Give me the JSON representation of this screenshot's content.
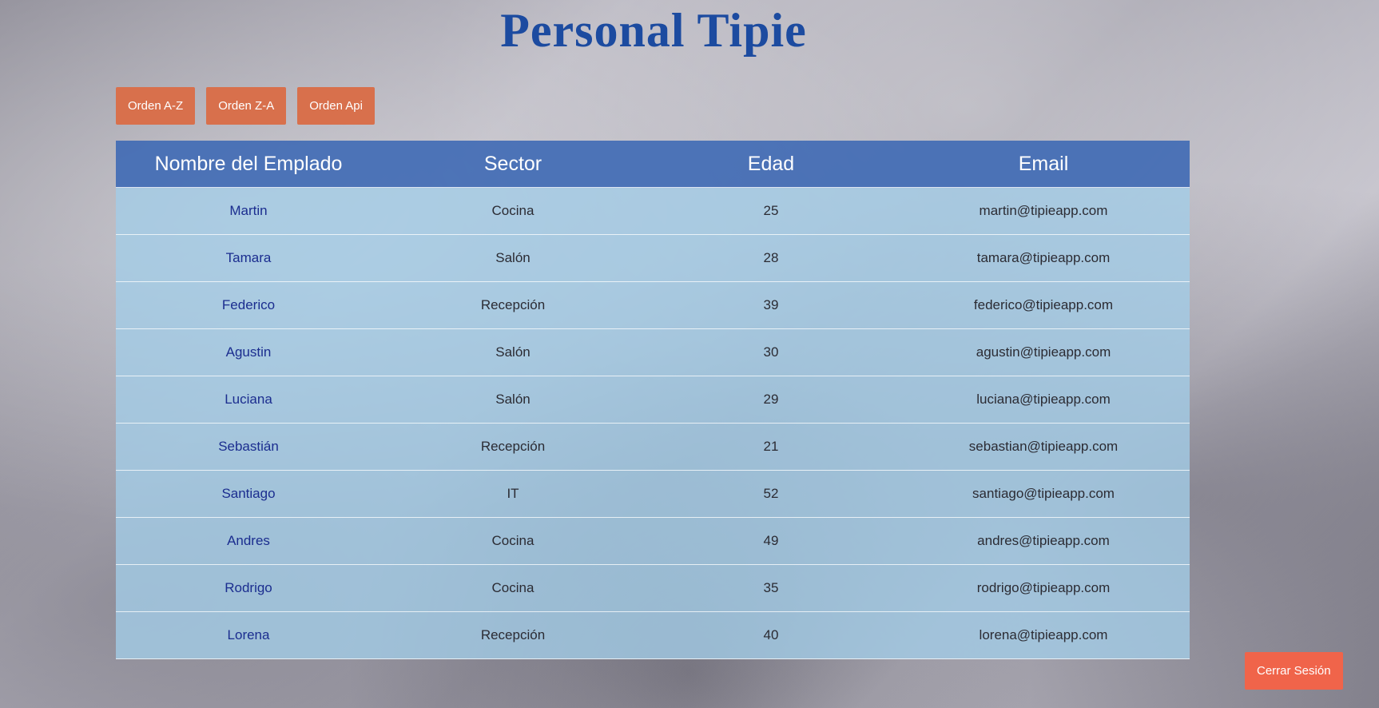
{
  "page": {
    "title": "Personal Tipie"
  },
  "sort_buttons": {
    "az": "Orden A-Z",
    "za": "Orden Z-A",
    "api": "Orden Api"
  },
  "table": {
    "headers": {
      "name": "Nombre del Emplado",
      "sector": "Sector",
      "age": "Edad",
      "email": "Email"
    },
    "rows": [
      {
        "name": "Martin",
        "sector": "Cocina",
        "age": "25",
        "email": "martin@tipieapp.com"
      },
      {
        "name": "Tamara",
        "sector": "Salón",
        "age": "28",
        "email": "tamara@tipieapp.com"
      },
      {
        "name": "Federico",
        "sector": "Recepción",
        "age": "39",
        "email": "federico@tipieapp.com"
      },
      {
        "name": "Agustin",
        "sector": "Salón",
        "age": "30",
        "email": "agustin@tipieapp.com"
      },
      {
        "name": "Luciana",
        "sector": "Salón",
        "age": "29",
        "email": "luciana@tipieapp.com"
      },
      {
        "name": "Sebastián",
        "sector": "Recepción",
        "age": "21",
        "email": "sebastian@tipieapp.com"
      },
      {
        "name": "Santiago",
        "sector": "IT",
        "age": "52",
        "email": "santiago@tipieapp.com"
      },
      {
        "name": "Andres",
        "sector": "Cocina",
        "age": "49",
        "email": "andres@tipieapp.com"
      },
      {
        "name": "Rodrigo",
        "sector": "Cocina",
        "age": "35",
        "email": "rodrigo@tipieapp.com"
      },
      {
        "name": "Lorena",
        "sector": "Recepción",
        "age": "40",
        "email": "lorena@tipieapp.com"
      }
    ]
  },
  "footer": {
    "logout_label": "Cerrar Sesión"
  },
  "colors": {
    "title": "#1c4ba0",
    "button": "#d8704c",
    "logout_button": "#f0644a",
    "table_header": "#3b68b4",
    "table_row": "#a3cde8",
    "name_text": "#1b2d8f"
  }
}
